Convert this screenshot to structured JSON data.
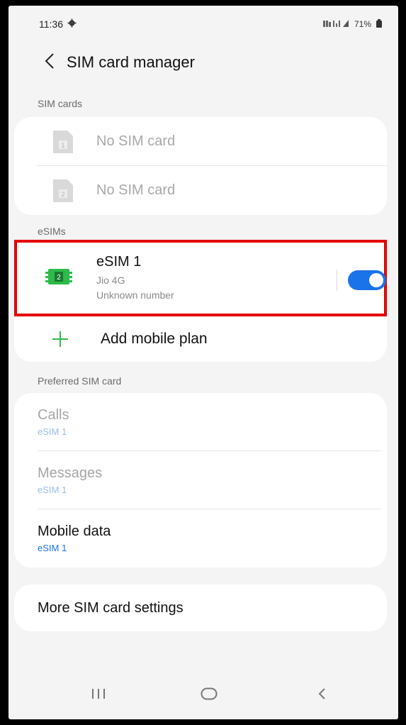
{
  "status": {
    "time": "11:36",
    "battery": "71%"
  },
  "header": {
    "title": "SIM card manager"
  },
  "sim_cards": {
    "label": "SIM cards",
    "items": [
      {
        "slot": "1",
        "label": "No SIM card"
      },
      {
        "slot": "2",
        "label": "No SIM card"
      }
    ]
  },
  "esims": {
    "label": "eSIMs",
    "items": [
      {
        "badge": "2",
        "name": "eSIM 1",
        "carrier": "Jio 4G",
        "number": "Unknown number",
        "enabled": true
      }
    ],
    "add_label": "Add mobile plan"
  },
  "preferred": {
    "label": "Preferred SIM card",
    "rows": [
      {
        "title": "Calls",
        "value": "eSIM 1"
      },
      {
        "title": "Messages",
        "value": "eSIM 1"
      },
      {
        "title": "Mobile data",
        "value": "eSIM 1"
      }
    ]
  },
  "more": {
    "label": "More SIM card settings"
  },
  "colors": {
    "accent": "#1a73e8",
    "highlight_border": "#e30000",
    "esim_green": "#2dbb4a"
  }
}
